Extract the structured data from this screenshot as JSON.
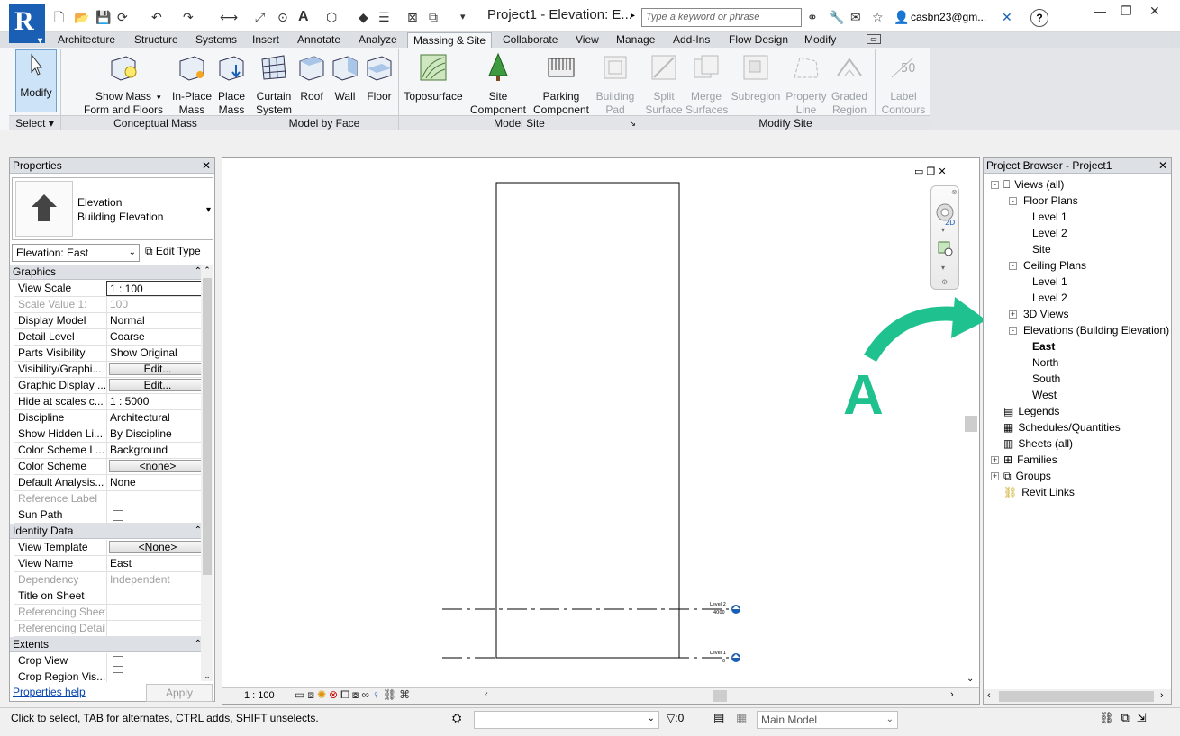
{
  "titlebar": {
    "logo": "R",
    "document_title": "Project1 - Elevation: E...",
    "search_placeholder": "Type a keyword or phrase",
    "user": "casbn23@gm...",
    "help_icon": "?",
    "text_tool": "A"
  },
  "tabs": [
    "Architecture",
    "Structure",
    "Systems",
    "Insert",
    "Annotate",
    "Analyze",
    "Massing & Site",
    "Collaborate",
    "View",
    "Manage",
    "Add-Ins",
    "Flow Design",
    "Modify"
  ],
  "active_tab": "Massing & Site",
  "ribbon": {
    "modify": "Modify",
    "select_label": "Select",
    "conceptual_mass": {
      "label": "Conceptual Mass",
      "tools": [
        "Show Mass\nForm and Floors",
        "In-Place\nMass",
        "Place\nMass"
      ]
    },
    "model_by_face": {
      "label": "Model by Face",
      "tools": [
        "Curtain\nSystem",
        "Roof",
        "Wall",
        "Floor"
      ]
    },
    "model_site": {
      "label": "Model Site",
      "tools": [
        "Toposurface",
        "Site\nComponent",
        "Parking\nComponent",
        "Building\nPad"
      ]
    },
    "modify_site": {
      "label": "Modify Site",
      "tools": [
        "Split\nSurface",
        "Merge\nSurfaces",
        "Subregion",
        "Property\nLine",
        "Graded\nRegion",
        "Label\nContours"
      ]
    }
  },
  "properties": {
    "title": "Properties",
    "type_name": "Elevation",
    "type_subname": "Building Elevation",
    "selector": "Elevation: East",
    "edit_type": "Edit Type",
    "groups": [
      {
        "name": "Graphics",
        "rows": [
          {
            "k": "View Scale",
            "v": "1 : 100",
            "kind": "input"
          },
          {
            "k": "Scale Value    1:",
            "v": "100",
            "dim": true
          },
          {
            "k": "Display Model",
            "v": "Normal"
          },
          {
            "k": "Detail Level",
            "v": "Coarse"
          },
          {
            "k": "Parts Visibility",
            "v": "Show Original"
          },
          {
            "k": "Visibility/Graphi...",
            "v": "Edit...",
            "kind": "button"
          },
          {
            "k": "Graphic Display ...",
            "v": "Edit...",
            "kind": "button"
          },
          {
            "k": "Hide at scales c...",
            "v": "1 : 5000"
          },
          {
            "k": "Discipline",
            "v": "Architectural"
          },
          {
            "k": "Show Hidden Li...",
            "v": "By Discipline"
          },
          {
            "k": "Color Scheme L...",
            "v": "Background"
          },
          {
            "k": "Color Scheme",
            "v": "<none>",
            "kind": "button"
          },
          {
            "k": "Default Analysis...",
            "v": "None"
          },
          {
            "k": "Reference Label",
            "v": "",
            "dim": true
          },
          {
            "k": "Sun Path",
            "v": "",
            "kind": "checkbox"
          }
        ]
      },
      {
        "name": "Identity Data",
        "rows": [
          {
            "k": "View Template",
            "v": "<None>",
            "kind": "button"
          },
          {
            "k": "View Name",
            "v": "East"
          },
          {
            "k": "Dependency",
            "v": "Independent",
            "dim": true
          },
          {
            "k": "Title on Sheet",
            "v": ""
          },
          {
            "k": "Referencing Sheet",
            "v": "",
            "dim": true
          },
          {
            "k": "Referencing Detail",
            "v": "",
            "dim": true
          }
        ]
      },
      {
        "name": "Extents",
        "rows": [
          {
            "k": "Crop View",
            "v": "",
            "kind": "checkbox"
          },
          {
            "k": "Crop Region Vis...",
            "v": "",
            "kind": "checkbox"
          }
        ]
      }
    ],
    "help_link": "Properties help",
    "apply": "Apply"
  },
  "canvas": {
    "scale": "1 : 100",
    "levels": [
      {
        "name": "Level 2",
        "elev": "4000"
      },
      {
        "name": "Level 1",
        "elev": "0"
      }
    ],
    "annotation": "A",
    "annotation_color": "#1fc28e"
  },
  "browser": {
    "title": "Project Browser - Project1",
    "nodes": [
      {
        "label": "Views (all)",
        "depth": 0,
        "toggle": "-",
        "icon": "views"
      },
      {
        "label": "Floor Plans",
        "depth": 1,
        "toggle": "-"
      },
      {
        "label": "Level 1",
        "depth": 2
      },
      {
        "label": "Level 2",
        "depth": 2
      },
      {
        "label": "Site",
        "depth": 2
      },
      {
        "label": "Ceiling Plans",
        "depth": 1,
        "toggle": "-"
      },
      {
        "label": "Level 1",
        "depth": 2
      },
      {
        "label": "Level 2",
        "depth": 2
      },
      {
        "label": "3D Views",
        "depth": 1,
        "toggle": "+"
      },
      {
        "label": "Elevations (Building Elevation)",
        "depth": 1,
        "toggle": "-"
      },
      {
        "label": "East",
        "depth": 2,
        "bold": true
      },
      {
        "label": "North",
        "depth": 2
      },
      {
        "label": "South",
        "depth": 2
      },
      {
        "label": "West",
        "depth": 2
      },
      {
        "label": "Legends",
        "depth": 0,
        "icon": "legend"
      },
      {
        "label": "Schedules/Quantities",
        "depth": 0,
        "icon": "schedule"
      },
      {
        "label": "Sheets (all)",
        "depth": 0,
        "icon": "sheet"
      },
      {
        "label": "Families",
        "depth": 0,
        "toggle": "+",
        "icon": "family"
      },
      {
        "label": "Groups",
        "depth": 0,
        "toggle": "+",
        "icon": "group"
      },
      {
        "label": "Revit Links",
        "depth": 0,
        "icon": "link"
      }
    ]
  },
  "status": {
    "message": "Click to select, TAB for alternates, CTRL adds, SHIFT unselects.",
    "filter_count": ":0",
    "model": "Main Model"
  }
}
